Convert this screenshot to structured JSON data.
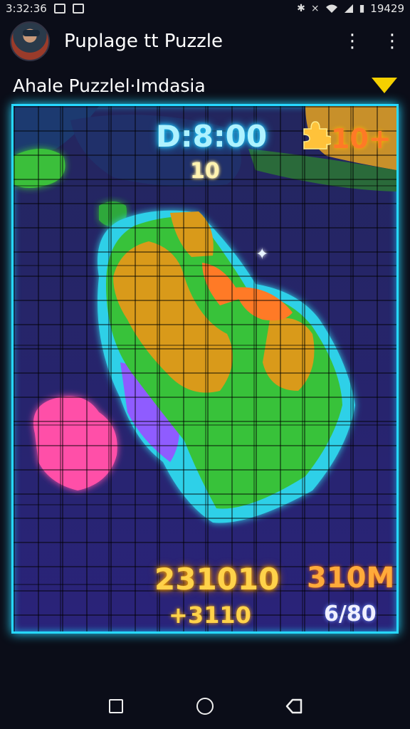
{
  "status_bar": {
    "time": "3:32:36",
    "clock_right": "19429",
    "icons": [
      "image-icon",
      "notification-icon",
      "bluetooth-icon",
      "mute-icon",
      "wifi-icon",
      "signal-icon",
      "battery-icon"
    ]
  },
  "app_bar": {
    "title": "Puplage tt Puzzle",
    "menu_icon": "more-vert-icon"
  },
  "subtitle": {
    "text": "Ahale Puzzlel·Imdasia",
    "dropdown_icon": "triangle-down-icon",
    "dropdown_color": "#f5d000"
  },
  "hud": {
    "timer": "D:8:00",
    "moves": "10",
    "top_score": "10+",
    "score": "231010",
    "bonus": "+3110",
    "target": "310M",
    "progress": "6/80",
    "piece_icon": "puzzle-piece-icon"
  },
  "board": {
    "border_color": "#27d8ff",
    "region_colors": [
      "#38c23a",
      "#d99a1a",
      "#ff4fa8",
      "#2ed0e8",
      "#8f5cff",
      "#ff7a26"
    ]
  },
  "nav_bar": {
    "icons": [
      "recents-icon",
      "home-icon",
      "back-icon"
    ]
  }
}
